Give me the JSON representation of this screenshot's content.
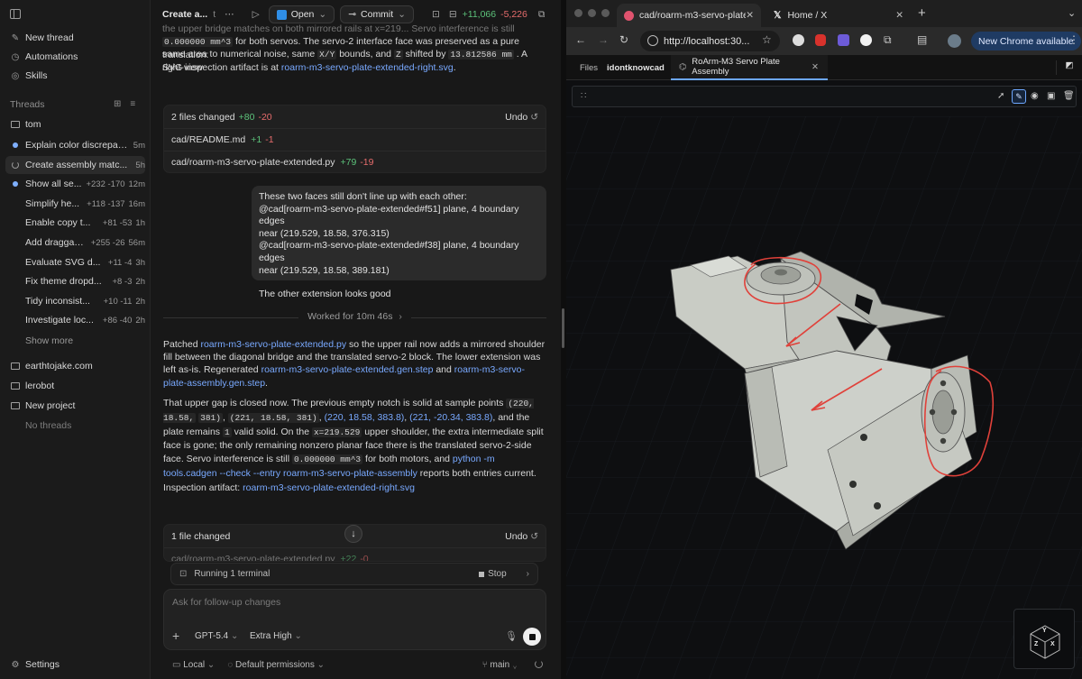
{
  "sidebar": {
    "new_thread": "New thread",
    "automations": "Automations",
    "skills": "Skills",
    "threads_header": "Threads",
    "folder_tom": "tom",
    "threads": [
      {
        "title": "Explain color discrepan...",
        "meta": "5m",
        "status": "unread"
      },
      {
        "title": "Create assembly matc...",
        "meta": "5h",
        "status": "running"
      },
      {
        "title": "Show all se...",
        "add": "+232",
        "del": "-170",
        "meta": "12m",
        "status": "unread"
      },
      {
        "title": "Simplify he...",
        "add": "+118",
        "del": "-137",
        "meta": "16m"
      },
      {
        "title": "Enable copy t...",
        "add": "+81",
        "del": "-53",
        "meta": "1h"
      },
      {
        "title": "Add draggab...",
        "add": "+255",
        "del": "-26",
        "meta": "56m"
      },
      {
        "title": "Evaluate SVG d...",
        "add": "+11",
        "del": "-4",
        "meta": "3h"
      },
      {
        "title": "Fix theme dropd...",
        "add": "+8",
        "del": "-3",
        "meta": "2h"
      },
      {
        "title": "Tidy inconsist...",
        "add": "+10",
        "del": "-11",
        "meta": "2h"
      },
      {
        "title": "Investigate loc...",
        "add": "+86",
        "del": "-40",
        "meta": "2h"
      }
    ],
    "show_more": "Show more",
    "projects": [
      "earthtojake.com",
      "lerobot",
      "New project"
    ],
    "no_threads": "No threads",
    "settings": "Settings"
  },
  "chat": {
    "title": "Create a...",
    "title_tail": "t",
    "open_label": "Open",
    "commit_label": "Commit",
    "diff_add": "+11,066",
    "diff_del": "-5,226",
    "intro": {
      "l0": "the upper bridge matches on both mirrored rails at x=219... Servo interference is still",
      "l1_code": "0.000000 mm^3",
      "l1": "for both servos. The servo-2 interface face was preserved as a pure translation:",
      "l2a": "same area to numerical noise, same",
      "l2_code1": "X/Y",
      "l2b": "bounds, and",
      "l2_code2": "Z",
      "l2c": "shifted by",
      "l2_code3": "13.812586 mm",
      "l2d": ". A right-view",
      "l3a": "SVG inspection artifact is at",
      "l3_link": "roarm-m3-servo-plate-extended-right.svg",
      "l3b": "."
    },
    "files_card": {
      "header": "2 files changed",
      "add": "+80",
      "del": "-20",
      "undo": "Undo",
      "files": [
        {
          "name": "cad/README.md",
          "add": "+1",
          "del": "-1"
        },
        {
          "name": "cad/roarm-m3-servo-plate-extended.py",
          "add": "+79",
          "del": "-19"
        }
      ]
    },
    "user_msg": {
      "l1": "These two faces still don't line up with each other:",
      "l2": "@cad[roarm-m3-servo-plate-extended#f51] plane, 4 boundary edges",
      "l3": "near (219.529, 18.58, 376.315)",
      "l4": "@cad[roarm-m3-servo-plate-extended#f38] plane, 4 boundary edges",
      "l5": "near (219.529, 18.58, 389.181)",
      "l6": "The other extension looks good"
    },
    "worked": "Worked for 10m 46s",
    "reply": {
      "p1a": "Patched",
      "p1_link": "roarm-m3-servo-plate-extended.py",
      "p1b": "so the upper rail now adds a mirrored shoulder fill",
      "p1c": "between the diagonal bridge and the translated servo-2 block. The lower extension was left as-is.",
      "p1d": "Regenerated",
      "p1_link2": "roarm-m3-servo-plate-extended.gen.step",
      "p1e": "and",
      "p1_link3": "roarm-m3-servo-plate-",
      "p1_link3b": "assembly.gen.step",
      "p1f": ".",
      "p2a": "That upper gap is closed now. The previous empty notch is solid at sample points",
      "p2_code1": "(220, 18.58,",
      "p2_code1b": "381)",
      "p2_code2": "(221, 18.58, 381)",
      "p2_link1": "(220, 18.58, 383.8)",
      "p2_link2": "(221, -20.34, 383.8)",
      "p2b": ", and the plate remains",
      "p2_code3": "1",
      "p2c": "valid solid. On the",
      "p2_code4": "x=219.529",
      "p2d": "upper shoulder, the extra intermediate split face is gone; the only",
      "p2e": "remaining nonzero planar face there is the translated servo-2-side face. Servo interference is still",
      "p2_code5": "0.000000 mm^3",
      "p2f": "for both motors, and",
      "p2_link3": "python -m tools.cadgen --check --entry roarm-m3-servo-",
      "p2_link3b": "plate-assembly",
      "p2g": "reports both entries current.",
      "p3a": "Inspection artifact:",
      "p3_link": "roarm-m3-servo-plate-extended-right.svg"
    },
    "files_card2": {
      "header": "1 file changed",
      "undo": "Undo",
      "file": "cad/roarm-m3-servo-plate-extended.py",
      "add": "+22",
      "del": "-0"
    },
    "terminal": {
      "label": "Running 1 terminal",
      "stop": "Stop"
    },
    "composer": {
      "placeholder": "Ask for follow-up changes",
      "model": "GPT-5.4",
      "effort": "Extra High"
    },
    "bottom": {
      "local": "Local",
      "permissions": "Default permissions",
      "branch": "main"
    }
  },
  "browser": {
    "tabs": [
      {
        "title": "cad/roarm-m3-servo-plate-e",
        "active": true
      },
      {
        "title": "Home / X",
        "active": false
      }
    ],
    "url": "http://localhost:30...",
    "new_chrome": "New Chrome available",
    "app_tabs": [
      "Files",
      "idontknowcad",
      "RoArm-M3 Servo Plate Assembly"
    ],
    "toolbar_handle": "∷",
    "axis": {
      "y": "Y",
      "z": "Z",
      "x": "X"
    }
  },
  "colors": {
    "accent_link": "#79a9ff",
    "add": "#5cc27a",
    "del": "#e66c6c",
    "annotation": "#e0413a"
  }
}
